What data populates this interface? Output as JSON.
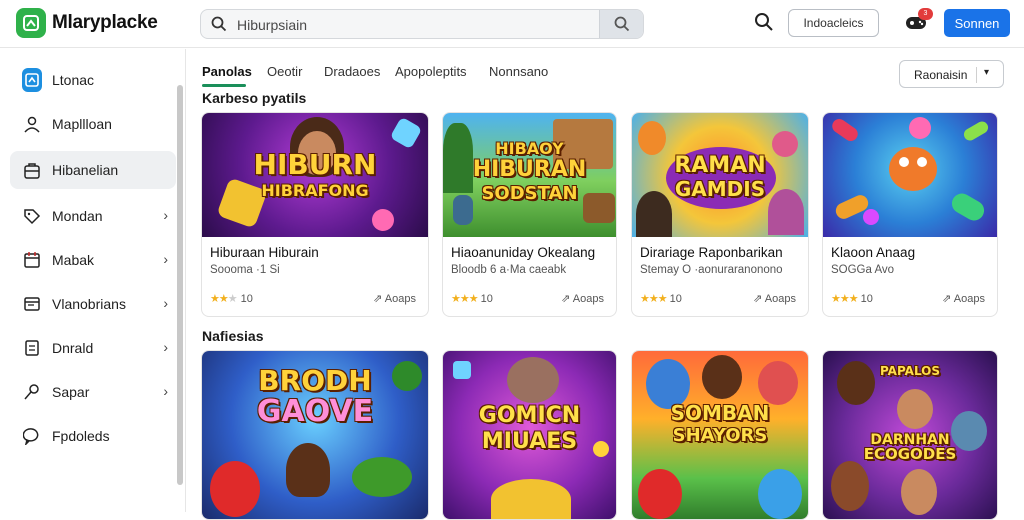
{
  "app": {
    "title": "Mlaryplacke"
  },
  "search": {
    "placeholder": "Hiburpsiain"
  },
  "header": {
    "outline_button": "Indoacleics",
    "primary_button": "Sonnen",
    "notification_count": "3"
  },
  "sidebar": {
    "items": [
      {
        "label": "Ltonac",
        "icon": "store-home-icon"
      },
      {
        "label": "Mapllloan",
        "icon": "person-icon"
      },
      {
        "label": "Hibanelian",
        "icon": "bag-icon"
      },
      {
        "label": "Mondan",
        "icon": "tag-icon"
      },
      {
        "label": "Mabak",
        "icon": "calendar-icon"
      },
      {
        "label": "Vlanobrians",
        "icon": "window-icon"
      },
      {
        "label": "Dnrald",
        "icon": "document-icon"
      },
      {
        "label": "Sapar",
        "icon": "key-icon"
      },
      {
        "label": "Fpdoleds",
        "icon": "bubble-icon"
      }
    ]
  },
  "tabs": [
    "Panolas",
    "Oeotir",
    "Dradaoes",
    "Apopoleptits",
    "Nonnsano"
  ],
  "sort_dropdown": {
    "label": "Raonaisin"
  },
  "sections": [
    {
      "title": "Karbeso pyatils",
      "cards": [
        {
          "name": "Hiburaan Hiburain",
          "subtitle": "Soooma ·1 Si",
          "rating": "10",
          "action": "Aoaps",
          "art_text": [
            "HIBURN",
            "HIBRAFONG"
          ]
        },
        {
          "name": "Hiaoanuniday Okealang",
          "subtitle": "Bloodb 6 a·Ma caeabk",
          "rating": "10",
          "action": "Aoaps",
          "art_text": [
            "HIBAOY",
            "HIBURAN",
            "SODSTAN"
          ]
        },
        {
          "name": "Dirariage Raponbarikan",
          "subtitle": "Stemay O ·aonuraranonono",
          "rating": "10",
          "action": "Aoaps",
          "art_text": [
            "RAMAN",
            "GAMDIS"
          ]
        },
        {
          "name": "Klaoon Anaag",
          "subtitle": "SOGGa Avo",
          "rating": "10",
          "action": "Aoaps",
          "art_text": []
        }
      ]
    },
    {
      "title": "Nafiesias",
      "cards": [
        {
          "art_text": [
            "BRODH",
            "GAOVE"
          ]
        },
        {
          "art_text": [
            "GOMICN",
            "MIUAES"
          ]
        },
        {
          "art_text": [
            "SOMBAN",
            "SHAYORS"
          ]
        },
        {
          "art_text": [
            "PAPALOS",
            "DARNHAN",
            "ECOGODES"
          ]
        }
      ]
    }
  ],
  "colors": {
    "accent": "#1a73e8",
    "brand": "#2fb14a",
    "tab_underline": "#1a8f5a",
    "star": "#f2b01e"
  }
}
